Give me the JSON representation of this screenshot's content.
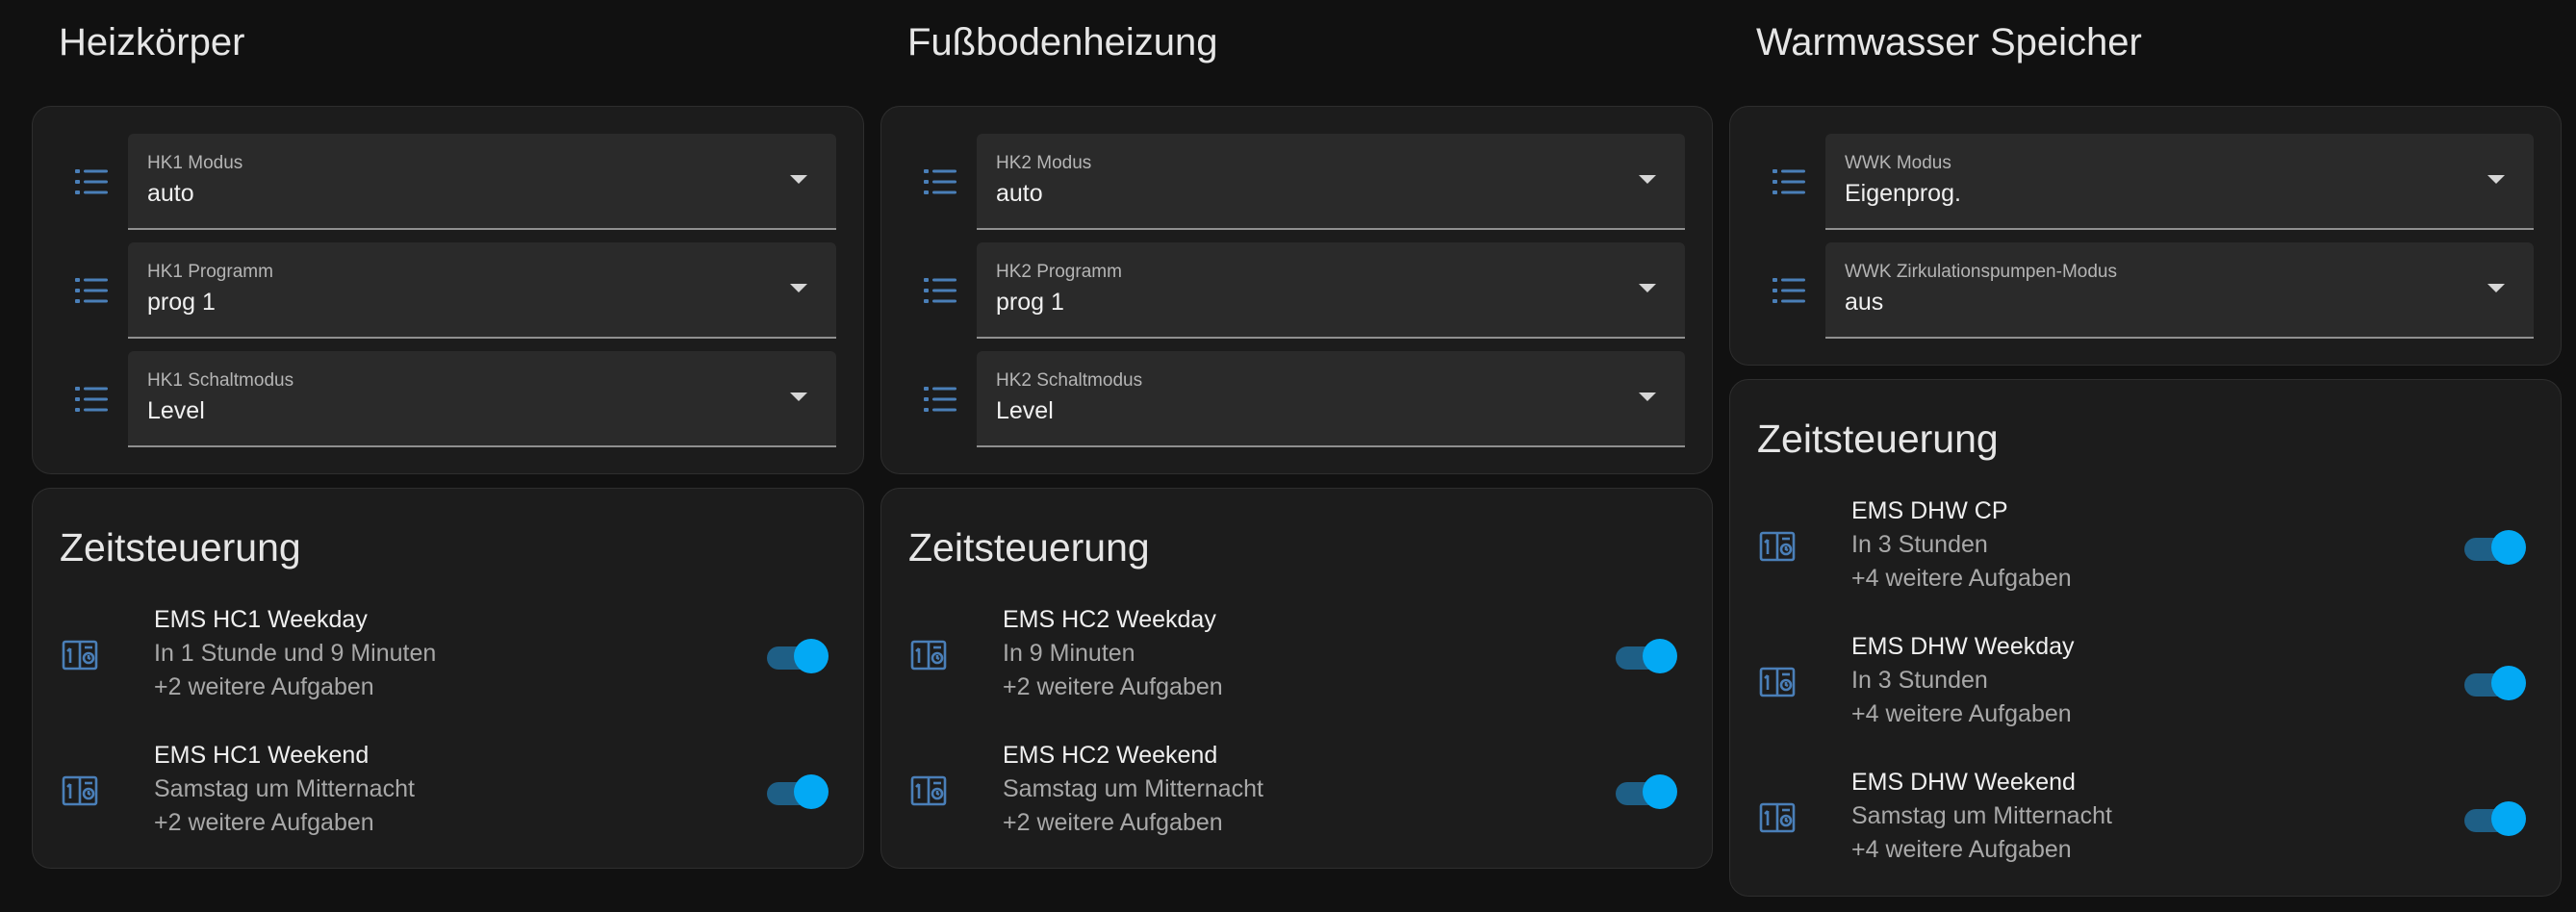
{
  "columns": [
    {
      "title": "Heizkörper",
      "selects": [
        {
          "label": "HK1 Modus",
          "value": "auto"
        },
        {
          "label": "HK1 Programm",
          "value": "prog 1"
        },
        {
          "label": "HK1 Schaltmodus",
          "value": "Level"
        }
      ],
      "schedule": {
        "title": "Zeitsteuerung",
        "items": [
          {
            "name": "EMS HC1 Weekday",
            "next": "In 1 Stunde und 9 Minuten",
            "more": "+2 weitere Aufgaben",
            "enabled": true
          },
          {
            "name": "EMS HC1 Weekend",
            "next": "Samstag um Mitternacht",
            "more": "+2 weitere Aufgaben",
            "enabled": true
          }
        ]
      }
    },
    {
      "title": "Fußbodenheizung",
      "selects": [
        {
          "label": "HK2 Modus",
          "value": "auto"
        },
        {
          "label": "HK2 Programm",
          "value": "prog 1"
        },
        {
          "label": "HK2 Schaltmodus",
          "value": "Level"
        }
      ],
      "schedule": {
        "title": "Zeitsteuerung",
        "items": [
          {
            "name": "EMS HC2 Weekday",
            "next": "In 9 Minuten",
            "more": "+2 weitere Aufgaben",
            "enabled": true
          },
          {
            "name": "EMS HC2 Weekend",
            "next": "Samstag um Mitternacht",
            "more": "+2 weitere Aufgaben",
            "enabled": true
          }
        ]
      }
    },
    {
      "title": "Warmwasser Speicher",
      "selects": [
        {
          "label": "WWK Modus",
          "value": "Eigenprog."
        },
        {
          "label": "WWK Zirkulationspumpen-Modus",
          "value": "aus"
        }
      ],
      "schedule": {
        "title": "Zeitsteuerung",
        "items": [
          {
            "name": "EMS DHW CP",
            "next": "In 3 Stunden",
            "more": "+4 weitere Aufgaben",
            "enabled": true
          },
          {
            "name": "EMS DHW Weekday",
            "next": "In 3 Stunden",
            "more": "+4 weitere Aufgaben",
            "enabled": true
          },
          {
            "name": "EMS DHW Weekend",
            "next": "Samstag um Mitternacht",
            "more": "+4 weitere Aufgaben",
            "enabled": true
          }
        ]
      }
    }
  ],
  "icons": {
    "select": "format-list-bulleted-icon",
    "schedule": "calendar-clock-icon"
  },
  "colors": {
    "background": "#111111",
    "card": "#1c1c1c",
    "accent": "#03a9f4",
    "icon": "#4a7fb8"
  }
}
